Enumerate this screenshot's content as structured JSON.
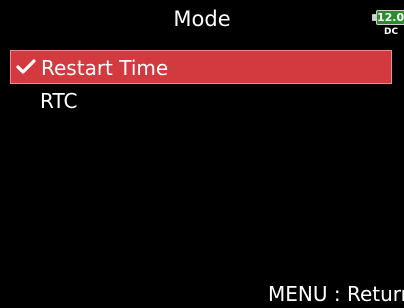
{
  "header": {
    "title": "Mode"
  },
  "status": {
    "battery_level": "12.0",
    "power_source": "DC",
    "battery_color": "#2a8c2a"
  },
  "menu": {
    "items": [
      {
        "label": "Restart Time",
        "selected": true,
        "icon": "checkmark-icon"
      },
      {
        "label": "RTC",
        "selected": false
      }
    ],
    "highlight_color": "#d23a3f"
  },
  "footer": {
    "hint": "MENU : Return"
  }
}
